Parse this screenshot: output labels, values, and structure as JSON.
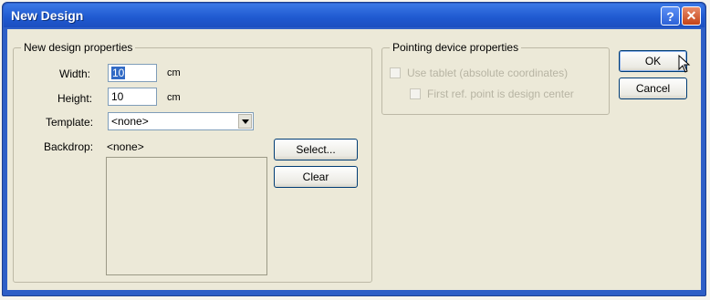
{
  "window": {
    "title": "New Design"
  },
  "design_properties": {
    "group_title": "New design properties",
    "width_label": "Width:",
    "width_value": "10",
    "width_unit": "cm",
    "height_label": "Height:",
    "height_value": "10",
    "height_unit": "cm",
    "template_label": "Template:",
    "template_value": "<none>",
    "backdrop_label": "Backdrop:",
    "backdrop_value": "<none>",
    "select_label": "Select...",
    "clear_label": "Clear"
  },
  "pointing": {
    "group_title": "Pointing device properties",
    "use_tablet_label": "Use tablet (absolute coordinates)",
    "use_tablet_checked": false,
    "first_ref_label": "First ref. point is design center",
    "first_ref_checked": false
  },
  "buttons": {
    "ok_label": "OK",
    "cancel_label": "Cancel"
  },
  "colors": {
    "title_bar": "#1f59d0",
    "dialog_face": "#ece9d8",
    "disabled_text": "#b7b4a3"
  },
  "icons": {
    "help": "help-icon",
    "close": "close-icon",
    "dropdown": "chevron-down-icon",
    "cursor": "mouse-pointer-icon"
  }
}
